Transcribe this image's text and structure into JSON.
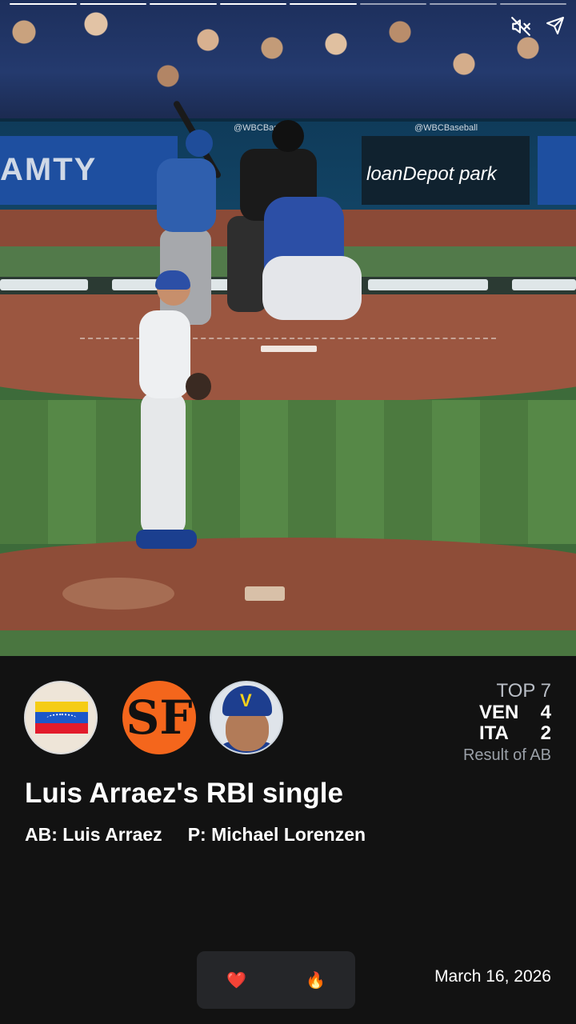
{
  "progress": {
    "total": 8,
    "current_index": 4
  },
  "wall_ads": {
    "left": "AMTY",
    "right": "loanDepot park",
    "tag": "@WBCBaseball"
  },
  "info": {
    "inning": "TOP 7",
    "teams": [
      {
        "abbr": "VEN",
        "score": "4"
      },
      {
        "abbr": "ITA",
        "score": "2"
      }
    ],
    "result_label": "Result of AB",
    "headline": "Luis Arraez's RBI single",
    "at_bat": "AB: Luis Arraez",
    "pitcher": "P: Michael Lorenzen",
    "date": "March 16, 2026",
    "sf_logo": "SF",
    "cap_letter": "V"
  },
  "reactions": {
    "heart": "❤️",
    "fire": "🔥"
  },
  "icons": {
    "mute": "mute-icon",
    "share": "share-icon",
    "team_flag": "venezuela-flag",
    "team_logo": "sf-giants-logo",
    "player": "player-headshot"
  },
  "colors": {
    "panel_bg": "#121212",
    "reaction_bg": "#252629",
    "sf_orange": "#f4661c"
  }
}
